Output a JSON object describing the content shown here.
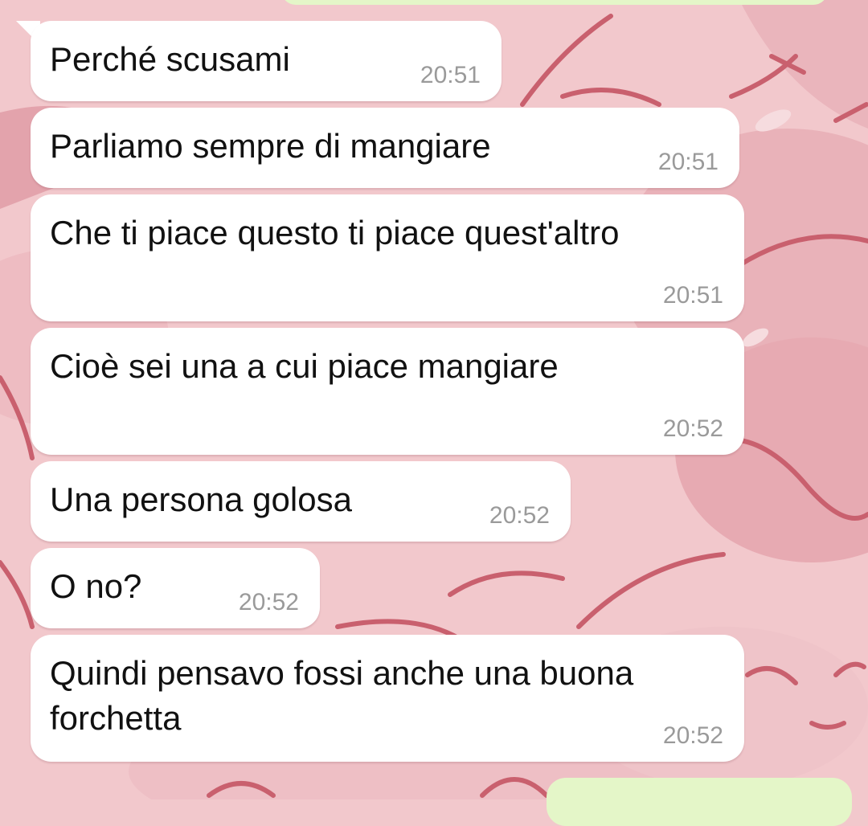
{
  "chat": {
    "messages": [
      {
        "text": "Perché scusami",
        "time": "20:51"
      },
      {
        "text": "Parliamo sempre di mangiare",
        "time": "20:51"
      },
      {
        "text": "Che ti piace questo ti piace quest'altro",
        "time": "20:51"
      },
      {
        "text": "Cioè sei una a cui piace mangiare",
        "time": "20:52"
      },
      {
        "text": "Una persona golosa",
        "time": "20:52"
      },
      {
        "text": "O no?",
        "time": "20:52"
      },
      {
        "text": "Quindi pensavo fossi anche una buona forchetta",
        "time": "20:52"
      }
    ]
  },
  "colors": {
    "wallpaper": "#f2c8cc",
    "incoming_bubble": "#ffffff",
    "outgoing_bubble": "#e4f6c8",
    "timestamp": "#9a9a9a",
    "doodle_stroke": "#c9606e"
  }
}
